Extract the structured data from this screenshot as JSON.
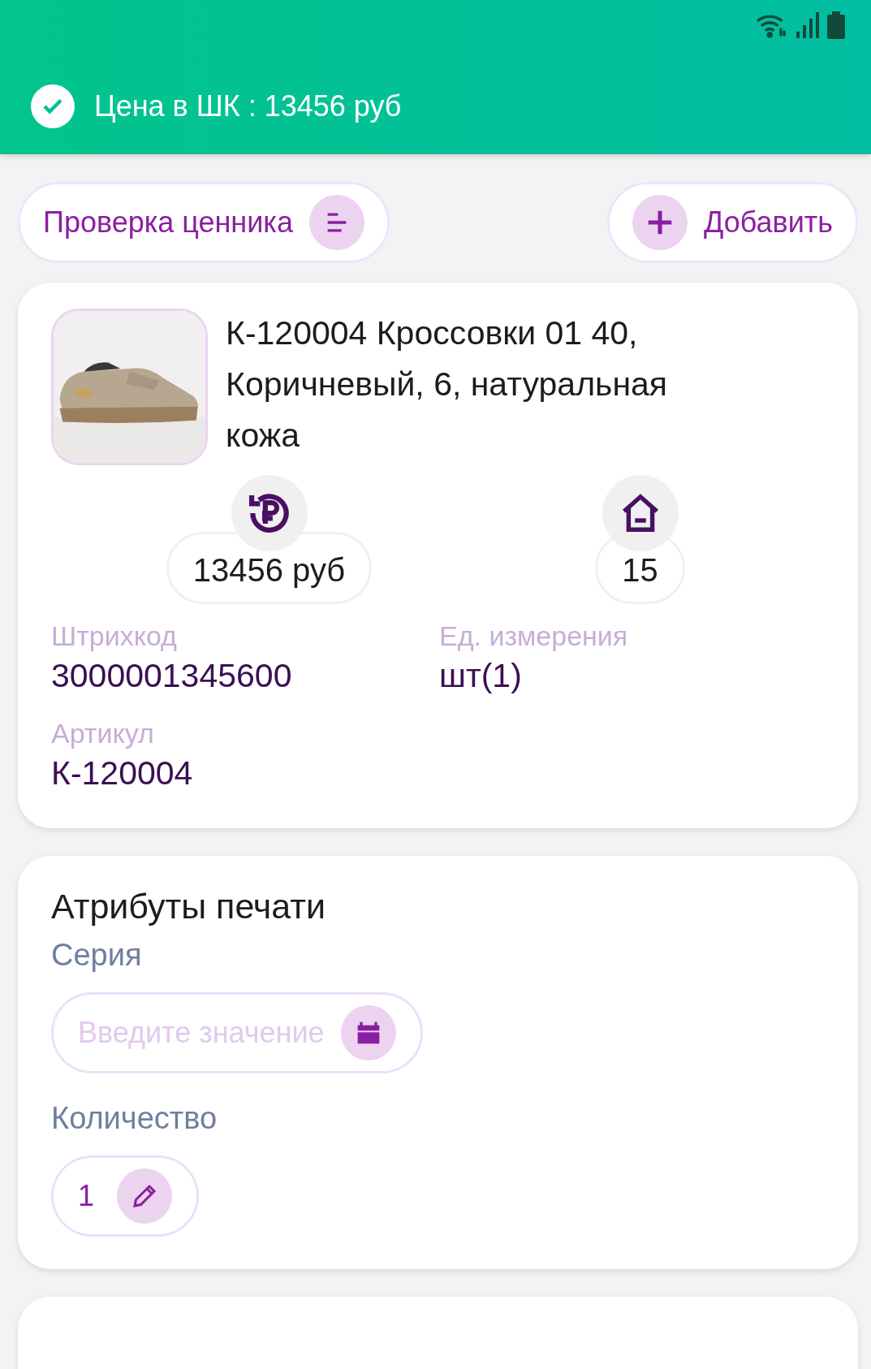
{
  "notification": {
    "kind": "success",
    "message": "Цена в ШК : 13456 руб"
  },
  "actions": [
    {
      "kind": "menu",
      "label": "Проверка ценника"
    },
    {
      "kind": "add",
      "label": "Добавить"
    }
  ],
  "product": {
    "title": "К-120004 Кроссовки 01 40, Коричневый, 6, натуральная кожа",
    "stats": [
      {
        "kind": "price",
        "value": "13456 руб"
      },
      {
        "kind": "stock",
        "value": "15"
      }
    ],
    "fields": [
      {
        "label": "Штрихкод",
        "value": "3000001345600"
      },
      {
        "label": "Ед. измерения",
        "value": "шт(1)"
      },
      {
        "label": "Артикул",
        "value": "К-120004"
      }
    ]
  },
  "print_attributes": {
    "title": "Атрибуты печати",
    "fields": [
      {
        "label": "Серия",
        "kind": "date",
        "placeholder": "Введите значение"
      },
      {
        "label": "Количество",
        "kind": "edit",
        "value": "1"
      }
    ]
  }
}
